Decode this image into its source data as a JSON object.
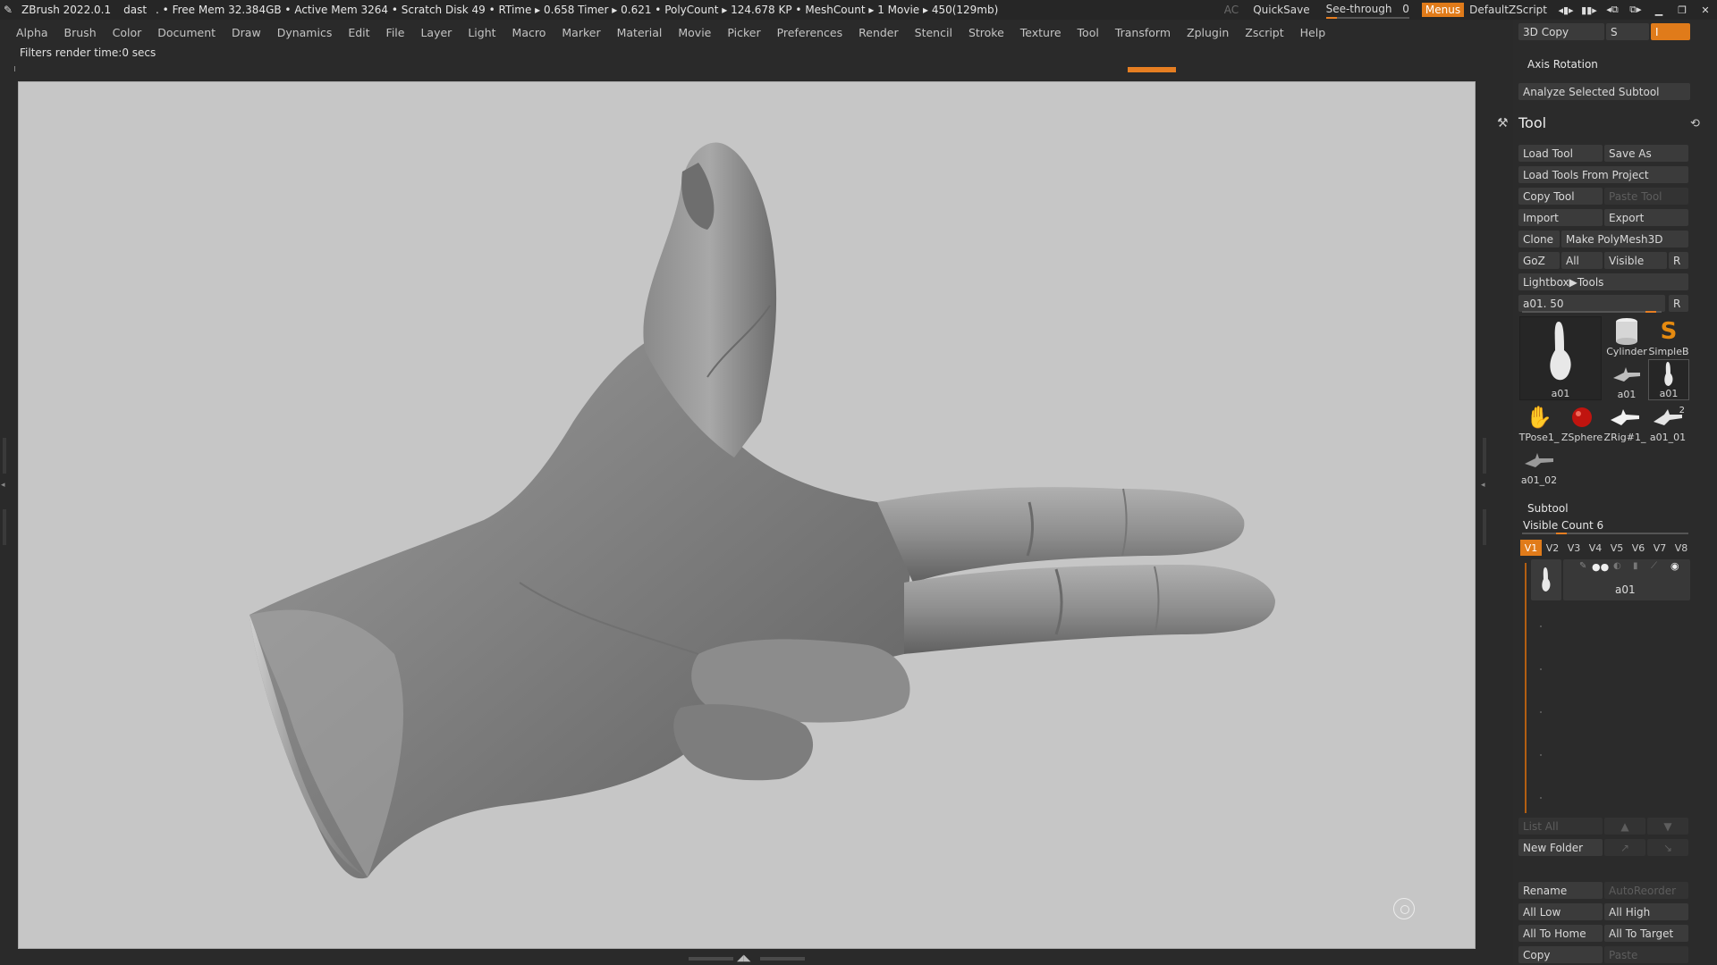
{
  "titlebar": {
    "app": "ZBrush 2022.0.1",
    "project": "dast",
    "stats": ". • Free Mem 32.384GB • Active Mem 3264 • Scratch Disk 49 • RTime ▸ 0.658 Timer ▸ 0.621 • PolyCount ▸ 124.678 KP • MeshCount ▸ 1  Movie ▸ 450(129mb)",
    "ac": "AC",
    "quicksave": "QuickSave",
    "see_through_label": "See-through",
    "see_through_value": "0",
    "menus": "Menus",
    "script": "DefaultZScript"
  },
  "menubar": [
    "Alpha",
    "Brush",
    "Color",
    "Document",
    "Draw",
    "Dynamics",
    "Edit",
    "File",
    "Layer",
    "Light",
    "Macro",
    "Marker",
    "Material",
    "Movie",
    "Picker",
    "Preferences",
    "Render",
    "Stencil",
    "Stroke",
    "Texture",
    "Tool",
    "Transform",
    "Zplugin",
    "Zscript",
    "Help"
  ],
  "info_text": "Filters render time:0 secs",
  "panel": {
    "copy3d": "3D Copy",
    "s_label": "S",
    "i_label": "I",
    "axis_rotation": "Axis Rotation",
    "analyze": "Analyze Selected Subtool",
    "tool_title": "Tool",
    "load_tool": "Load Tool",
    "save_as": "Save As",
    "load_from_project": "Load Tools From Project",
    "copy_tool": "Copy Tool",
    "paste_tool": "Paste Tool",
    "import": "Import",
    "export": "Export",
    "clone": "Clone",
    "make_polymesh": "Make PolyMesh3D",
    "goz": "GoZ",
    "all": "All",
    "visible": "Visible",
    "r": "R",
    "lightbox_tools": "Lightbox▶Tools",
    "current_tool": "a01. 50",
    "tools": [
      "a01",
      "Cylinder",
      "SimpleB",
      "a01",
      "a01",
      "TPose1_",
      "ZSphere",
      "ZRig#1_",
      "a01_01",
      "a01_02"
    ],
    "a01_01_badge": "2",
    "subtool": "Subtool",
    "visible_count": "Visible Count 6",
    "vtabs": [
      "V1",
      "V2",
      "V3",
      "V4",
      "V5",
      "V6",
      "V7",
      "V8"
    ],
    "subtool_name": "a01",
    "list_all": "List All",
    "new_folder": "New Folder",
    "rename": "Rename",
    "auto_reorder": "AutoReorder",
    "all_low": "All Low",
    "all_high": "All High",
    "all_to_home": "All To Home",
    "all_to_target": "All To Target",
    "copy": "Copy",
    "paste": "Paste"
  }
}
